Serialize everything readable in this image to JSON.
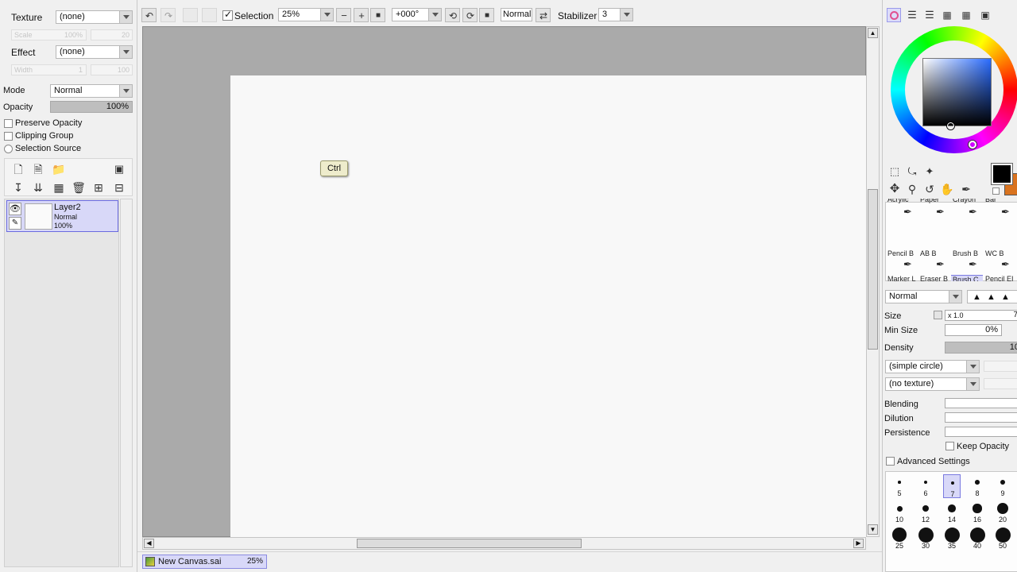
{
  "left_panel": {
    "texture_label": "Texture",
    "texture_value": "(none)",
    "scale_label": "Scale",
    "scale_value": "100%",
    "scale_num": "20",
    "effect_label": "Effect",
    "effect_value": "(none)",
    "width_label": "Width",
    "width_value": "1",
    "width_num": "100",
    "mode_label": "Mode",
    "mode_value": "Normal",
    "opacity_label": "Opacity",
    "opacity_value": "100%",
    "opacity_fraction": 1.0,
    "preserve_opacity": "Preserve Opacity",
    "clipping_group": "Clipping Group",
    "selection_source": "Selection Source"
  },
  "layers": [
    {
      "name": "Layer2",
      "mode": "Normal",
      "opacity": "100%"
    }
  ],
  "toolbar": {
    "selection_label": "Selection",
    "zoom_value": "25%",
    "rotation_value": "+000°",
    "blend_mode": "Normal",
    "stabilizer_label": "Stabilizer",
    "stabilizer_value": "3"
  },
  "canvas": {
    "ctrl_key_hint": "Ctrl"
  },
  "status_bar": {
    "document_name": "New Canvas.sai",
    "document_zoom": "25%"
  },
  "brush_panel": {
    "top_row_labels": [
      "Acrylic",
      "Paper",
      "Crayon",
      "Bar"
    ],
    "row2_labels": [
      "Pencil B",
      "AB B",
      "Brush B",
      "WC B"
    ],
    "row3_labels": [
      "Marker L",
      "Eraser B",
      "Brush C",
      "Pencil EI"
    ],
    "mode_value": "Normal",
    "size_label": "Size",
    "size_multiplier": "x 1.0",
    "size_value": "7",
    "min_size_label": "Min Size",
    "min_size_value": "0%",
    "density_label": "Density",
    "density_value": "10",
    "shape_value": "(simple circle)",
    "texture_value": "(no texture)",
    "blending_label": "Blending",
    "dilution_label": "Dilution",
    "persistence_label": "Persistence",
    "keep_opacity_label": "Keep Opacity",
    "advanced_settings_label": "Advanced Settings",
    "size_presets": [
      "5",
      "6",
      "7",
      "8",
      "9",
      "10",
      "12",
      "14",
      "16",
      "20",
      "25",
      "30",
      "35",
      "40",
      "50"
    ]
  },
  "colors": {
    "primary": "#000000",
    "secondary": "#d9731f",
    "layer_highlight": "#d8d8f8",
    "canvas_bg": "#f8f8f8",
    "workspace_bg": "#aaaaaa"
  }
}
